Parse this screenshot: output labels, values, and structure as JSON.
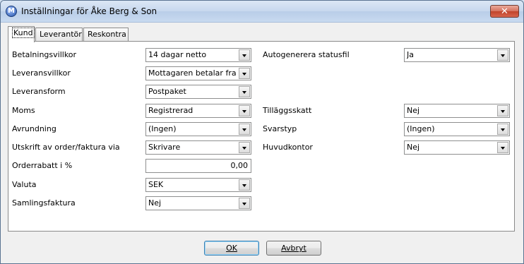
{
  "window": {
    "title": "Inställningar för Åke Berg & Son",
    "app_icon_glyph": "M",
    "close_glyph": "✕"
  },
  "tabs": [
    "Kund",
    "Leverantör",
    "Reskontra"
  ],
  "left_fields": [
    {
      "label": "Betalningsvillkor",
      "value": "14 dagar netto"
    },
    {
      "label": "Leveransvillkor",
      "value": "Mottagaren betalar fraktko"
    },
    {
      "label": "Leveransform",
      "value": "Postpaket"
    },
    {
      "label": "Moms",
      "value": "Registrerad"
    },
    {
      "label": "Avrundning",
      "value": "(Ingen)"
    },
    {
      "label": "Utskrift av order/faktura via",
      "value": "Skrivare"
    },
    {
      "label": "Orderrabatt i %",
      "value": "0,00"
    },
    {
      "label": "Valuta",
      "value": "SEK"
    },
    {
      "label": "Samlingsfaktura",
      "value": "Nej"
    }
  ],
  "right_fields": [
    {
      "label": "Autogenerera statusfil",
      "value": "Ja"
    },
    {
      "label": "Tilläggsskatt",
      "value": "Nej"
    },
    {
      "label": "Svarstyp",
      "value": "(Ingen)"
    },
    {
      "label": "Huvudkontor",
      "value": "Nej"
    }
  ],
  "buttons": {
    "ok": "OK",
    "cancel": "Avbryt"
  }
}
